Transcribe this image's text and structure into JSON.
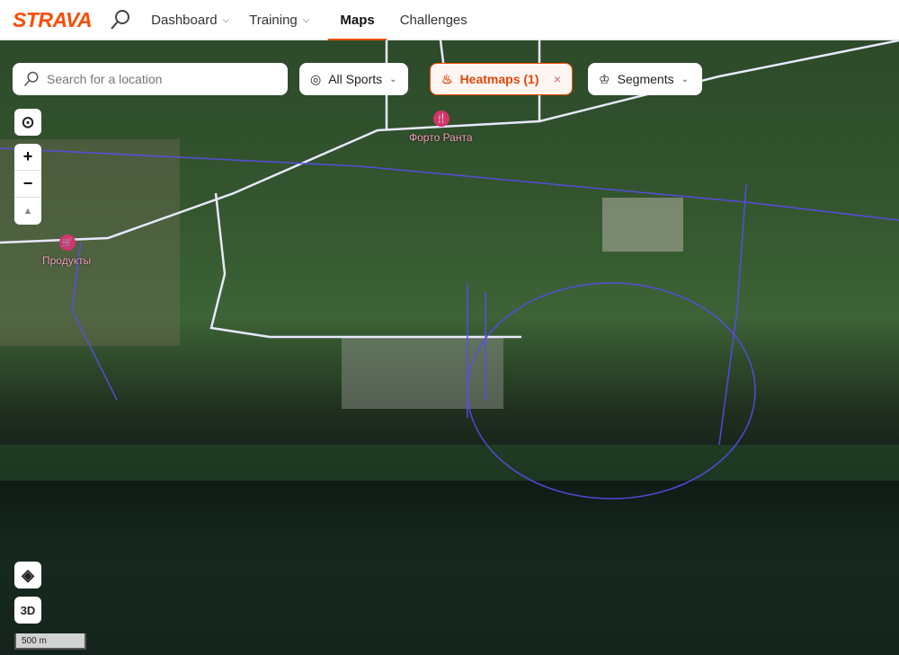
{
  "nav": {
    "logo": "STRAVA",
    "items": [
      {
        "label": "Dashboard",
        "chev": "⌵"
      },
      {
        "label": "Training",
        "chev": "⌵"
      },
      {
        "label": "Maps"
      },
      {
        "label": "Challenges"
      }
    ]
  },
  "search": {
    "placeholder": "Search for a location"
  },
  "filters": {
    "sports": "All Sports",
    "heatmaps": "Heatmaps (1)",
    "close": "×",
    "segments": "Segments",
    "chev": "⌄"
  },
  "controls": {
    "zoom_in": "+",
    "zoom_out": "−",
    "compass": "▲",
    "three_d": "3D"
  },
  "poi": [
    {
      "name": "Форто Ранта"
    },
    {
      "name": "Продукты"
    }
  ],
  "scale": "500 m",
  "colors": {
    "accent": "#fc4c02",
    "heat": "#5b4cf0"
  }
}
